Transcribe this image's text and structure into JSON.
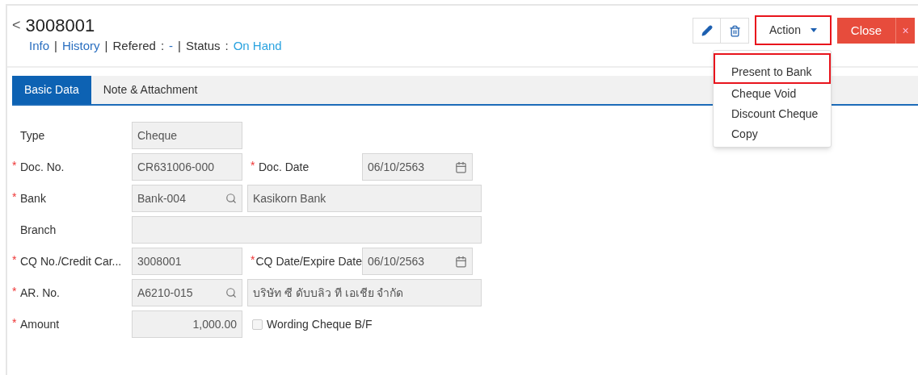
{
  "header": {
    "back": "<",
    "title": "3008001",
    "links": [
      {
        "kind": "link",
        "text": "Info"
      },
      {
        "kind": "sep",
        "text": "|"
      },
      {
        "kind": "link",
        "text": "History"
      },
      {
        "kind": "sep",
        "text": "|"
      },
      {
        "kind": "plain",
        "text": "Refered"
      },
      {
        "kind": "plain",
        "text": ":"
      },
      {
        "kind": "link",
        "text": "-"
      },
      {
        "kind": "sep",
        "text": "|"
      },
      {
        "kind": "plain",
        "text": "Status"
      },
      {
        "kind": "plain",
        "text": ":"
      },
      {
        "kind": "status",
        "text": "On Hand"
      }
    ]
  },
  "toolbar": {
    "action": {
      "label": "Action",
      "highlighted": true
    },
    "close": {
      "label": "Close",
      "dismiss": "×"
    }
  },
  "menu": [
    {
      "label": "Present to Bank",
      "highlighted": true
    },
    {
      "label": "Cheque Void",
      "highlighted": false
    },
    {
      "label": "Discount Cheque",
      "highlighted": false
    },
    {
      "label": "Copy",
      "highlighted": false
    }
  ],
  "tabs": [
    {
      "label": "Basic Data",
      "selected": true
    },
    {
      "label": "Note & Attachment",
      "selected": false
    }
  ],
  "rows": [
    {
      "label": "Type",
      "fields": [
        {
          "kind": "text",
          "value": "Cheque"
        }
      ]
    },
    {
      "mark": "*",
      "label": "Doc. No.",
      "fields": [
        {
          "kind": "text",
          "value": "CR631006-000"
        },
        {
          "kind": "label",
          "mark": "*",
          "label": "Doc. Date"
        },
        {
          "kind": "date",
          "value": "06/10/2563"
        }
      ]
    },
    {
      "mark": "*",
      "label": "Bank",
      "fields": [
        {
          "kind": "lookup",
          "value": "Bank-004"
        },
        {
          "kind": "wide",
          "value": "Kasikorn Bank"
        }
      ]
    },
    {
      "label": "Branch",
      "fields": [
        {
          "kind": "full"
        }
      ]
    },
    {
      "mark": "*",
      "label": "CQ No./Credit Car...",
      "fields": [
        {
          "kind": "text",
          "value": "3008001"
        },
        {
          "kind": "label",
          "mark": "*",
          "label": "CQ Date/Expire Date"
        },
        {
          "kind": "date",
          "value": "06/10/2563"
        }
      ]
    },
    {
      "mark": "*",
      "label": "AR. No.",
      "fields": [
        {
          "kind": "lookup",
          "value": "A6210-015"
        },
        {
          "kind": "wide",
          "value": "บริษัท ซี ดับบลิว ที เอเชีย จำกัด"
        }
      ]
    },
    {
      "mark": "*",
      "label": "Amount",
      "fields": [
        {
          "kind": "amount",
          "value": "1,000.00"
        },
        {
          "kind": "checkbox",
          "label": "Wording Cheque B/F",
          "checked": false
        }
      ]
    }
  ]
}
